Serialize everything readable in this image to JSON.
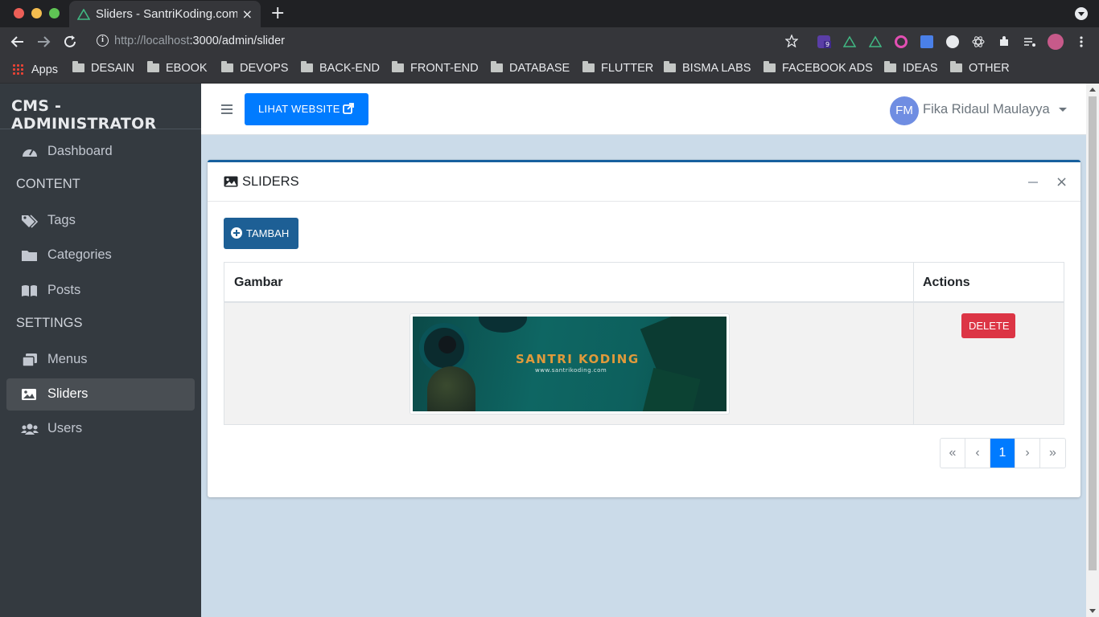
{
  "browser": {
    "tab_title": "Sliders - SantriKoding.com",
    "tab_close": "×",
    "new_tab": "+",
    "url_host": "http://localhost",
    "url_path": ":3000/admin/slider",
    "extension_badge": "9",
    "bookmarks": [
      {
        "label": "Apps",
        "type": "apps"
      },
      {
        "label": "DESAIN",
        "type": "folder"
      },
      {
        "label": "EBOOK",
        "type": "folder"
      },
      {
        "label": "DEVOPS",
        "type": "folder"
      },
      {
        "label": "BACK-END",
        "type": "folder"
      },
      {
        "label": "FRONT-END",
        "type": "folder"
      },
      {
        "label": "DATABASE",
        "type": "folder"
      },
      {
        "label": "FLUTTER",
        "type": "folder"
      },
      {
        "label": "BISMA LABS",
        "type": "folder"
      },
      {
        "label": "FACEBOOK ADS",
        "type": "folder"
      },
      {
        "label": "IDEAS",
        "type": "folder"
      },
      {
        "label": "OTHER",
        "type": "folder"
      }
    ]
  },
  "sidebar": {
    "brand": "CMS - ADMINISTRATOR",
    "items": [
      {
        "label": "Dashboard",
        "icon": "tachometer-icon"
      },
      {
        "header": "CONTENT"
      },
      {
        "label": "Tags",
        "icon": "tags-icon"
      },
      {
        "label": "Categories",
        "icon": "folder-icon"
      },
      {
        "label": "Posts",
        "icon": "book-icon"
      },
      {
        "header": "SETTINGS"
      },
      {
        "label": "Menus",
        "icon": "clone-icon"
      },
      {
        "label": "Sliders",
        "icon": "image-icon",
        "active": true
      },
      {
        "label": "Users",
        "icon": "users-icon"
      }
    ]
  },
  "topnav": {
    "website_button": "LIHAT WEBSITE",
    "avatar_initials": "FM",
    "user_name": "Fika Ridaul Maulayya"
  },
  "card": {
    "title": "SLIDERS",
    "add_button": "TAMBAH",
    "table": {
      "headers": [
        "Gambar",
        "Actions"
      ],
      "rows": [
        {
          "image": {
            "title": "SANTRI KODING",
            "subtitle": "www.santrikoding.com"
          },
          "action": "DELETE"
        }
      ]
    },
    "pagination": [
      "«",
      "‹",
      "1",
      "›",
      "»"
    ],
    "current_page": "1"
  },
  "colors": {
    "sidebar_bg": "#343a40",
    "primary": "#007bff",
    "card_accent": "#17609e",
    "danger": "#dc3545",
    "content_bg": "#cbdbe9"
  }
}
